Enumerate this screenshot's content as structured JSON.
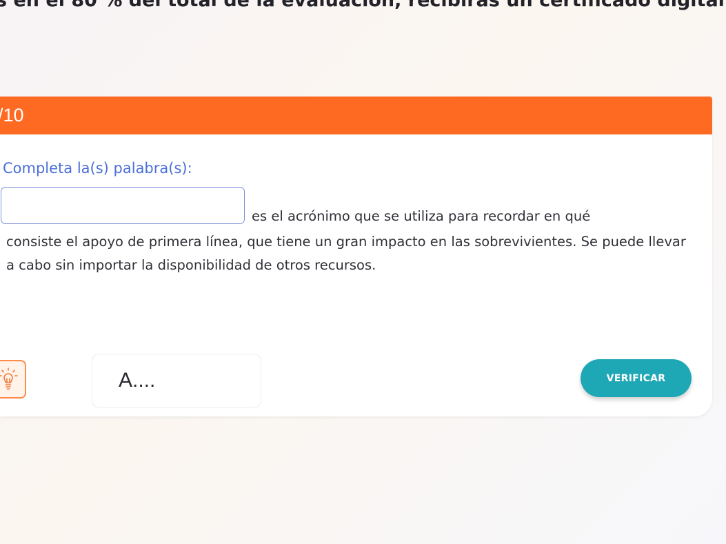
{
  "header": {
    "note": "s en el 80 % del total de la evaluación, recibirás un certificado digital"
  },
  "progress": {
    "text": "/10"
  },
  "question": {
    "instruction": "Completa la(s) palabra(s):",
    "answer_value": "",
    "sentence_first_line": "es el acrónimo que se utiliza para recordar en qué",
    "sentence_rest": "consiste el apoyo de primera línea, que tiene un gran impacto en las sobrevivientes. Se puede llevar a cabo sin importar la disponibilidad de otros recursos."
  },
  "hint": {
    "icon": "lightbulb-icon",
    "text": "A...."
  },
  "actions": {
    "verify_label": "VERIFICAR"
  },
  "colors": {
    "accent_orange": "#ff6a22",
    "instruction_blue": "#4a6fd8",
    "verify_teal": "#1ea7b5"
  }
}
